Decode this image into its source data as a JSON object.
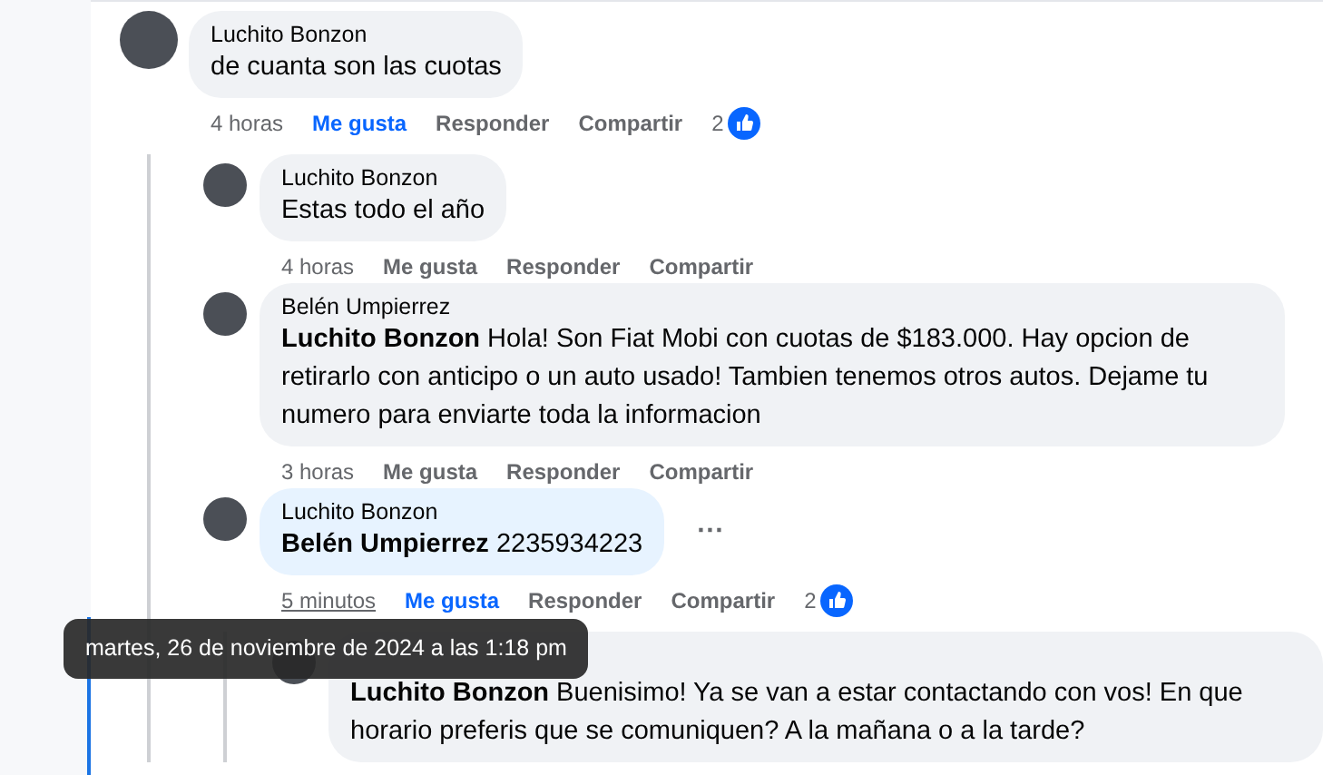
{
  "comments": [
    {
      "author": "Luchito Bonzon",
      "text": "de cuanta son las cuotas",
      "time": "4 horas",
      "time_hovered": false,
      "liked": true,
      "actions": [
        "Me gusta",
        "Responder",
        "Compartir"
      ],
      "reactions": "2",
      "children": [
        {
          "author": "Luchito Bonzon",
          "text": "Estas todo el año",
          "time": "4 horas",
          "time_hovered": false,
          "liked": false,
          "actions": [
            "Me gusta",
            "Responder",
            "Compartir"
          ]
        },
        {
          "author": "Belén Umpierrez",
          "text": "**Luchito Bonzon** Hola! Son Fiat Mobi con cuotas de $183.000. Hay opcion de retirarlo con anticipo o un auto usado! Tambien tenemos otros autos. Dejame tu numero para enviarte toda la informacion",
          "time": "3 horas",
          "time_hovered": false,
          "liked": false,
          "actions": [
            "Me gusta",
            "Responder",
            "Compartir"
          ]
        },
        {
          "author": "Luchito Bonzon",
          "text": "**Belén Umpierrez** 2235934223",
          "mine": true,
          "menu": "···",
          "time": "5 minutos",
          "time_hovered": true,
          "liked": true,
          "actions": [
            "Me gusta",
            "Responder",
            "Compartir"
          ],
          "reactions": "2",
          "children": [
            {
              "text": "**Luchito Bonzon** Buenisimo! Ya se van a estar contactando con vos! En que horario preferis que se comuniquen? A la mañana o a la tarde?"
            }
          ]
        }
      ]
    }
  ],
  "tooltip": "martes, 26 de noviembre de 2024 a las 1:18 pm"
}
